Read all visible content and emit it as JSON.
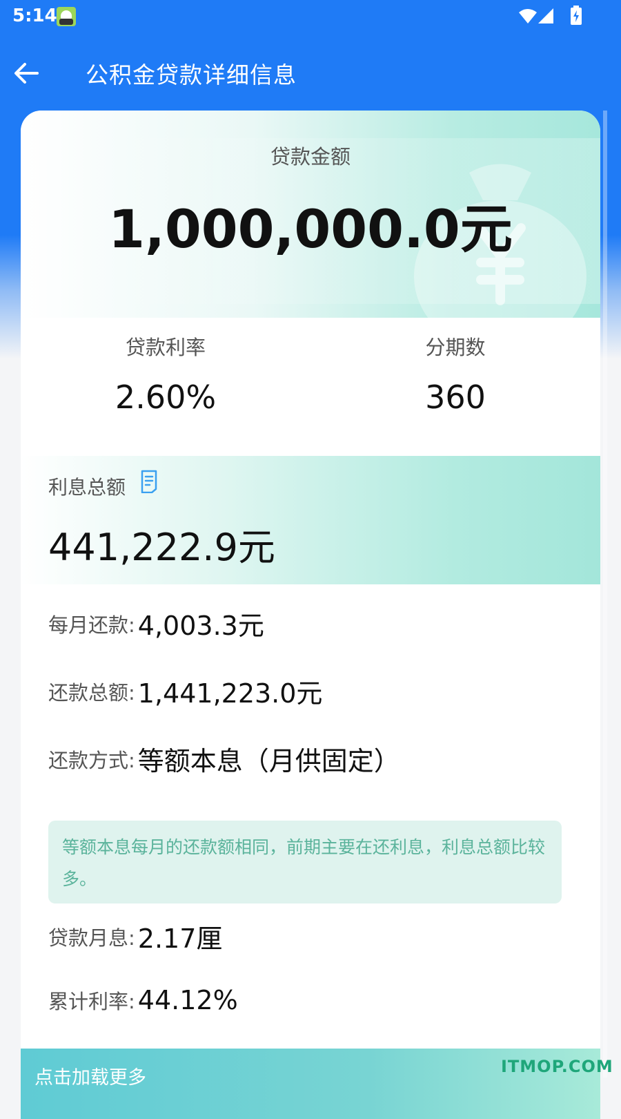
{
  "status_bar": {
    "time": "5:14"
  },
  "app_bar": {
    "title": "公积金贷款详细信息"
  },
  "loan": {
    "label": "贷款金额",
    "amount": "1,000,000.0元"
  },
  "stats": {
    "rate_label": "贷款利率",
    "rate_value": "2.60%",
    "periods_label": "分期数",
    "periods_value": "360"
  },
  "interest": {
    "label": "利息总额",
    "amount": "441,222.9元"
  },
  "details": [
    {
      "key": "每月还款:",
      "value": "4,003.3元"
    },
    {
      "key": "还款总额:",
      "value": "1,441,223.0元"
    },
    {
      "key": "还款方式:",
      "value": "等额本息（月供固定）"
    }
  ],
  "tip": {
    "text": "等额本息每月的还款额相同，前期主要在还利息，利息总额比较多。"
  },
  "details2": [
    {
      "key": "贷款月息:",
      "value": "2.17厘"
    },
    {
      "key": "累计利率:",
      "value": "44.12%"
    }
  ],
  "load_more": {
    "label": "点击加载更多"
  },
  "watermark": {
    "text": "ITMOP.COM"
  },
  "colors": {
    "primary": "#1f7bf6",
    "teal": "#a6e7dc",
    "tip_text": "#5ab39b",
    "tip_bg": "#dff3ee"
  },
  "icons": [
    "back-arrow-icon",
    "wifi-icon",
    "signal-icon",
    "battery-icon",
    "money-bag-icon",
    "document-icon"
  ]
}
